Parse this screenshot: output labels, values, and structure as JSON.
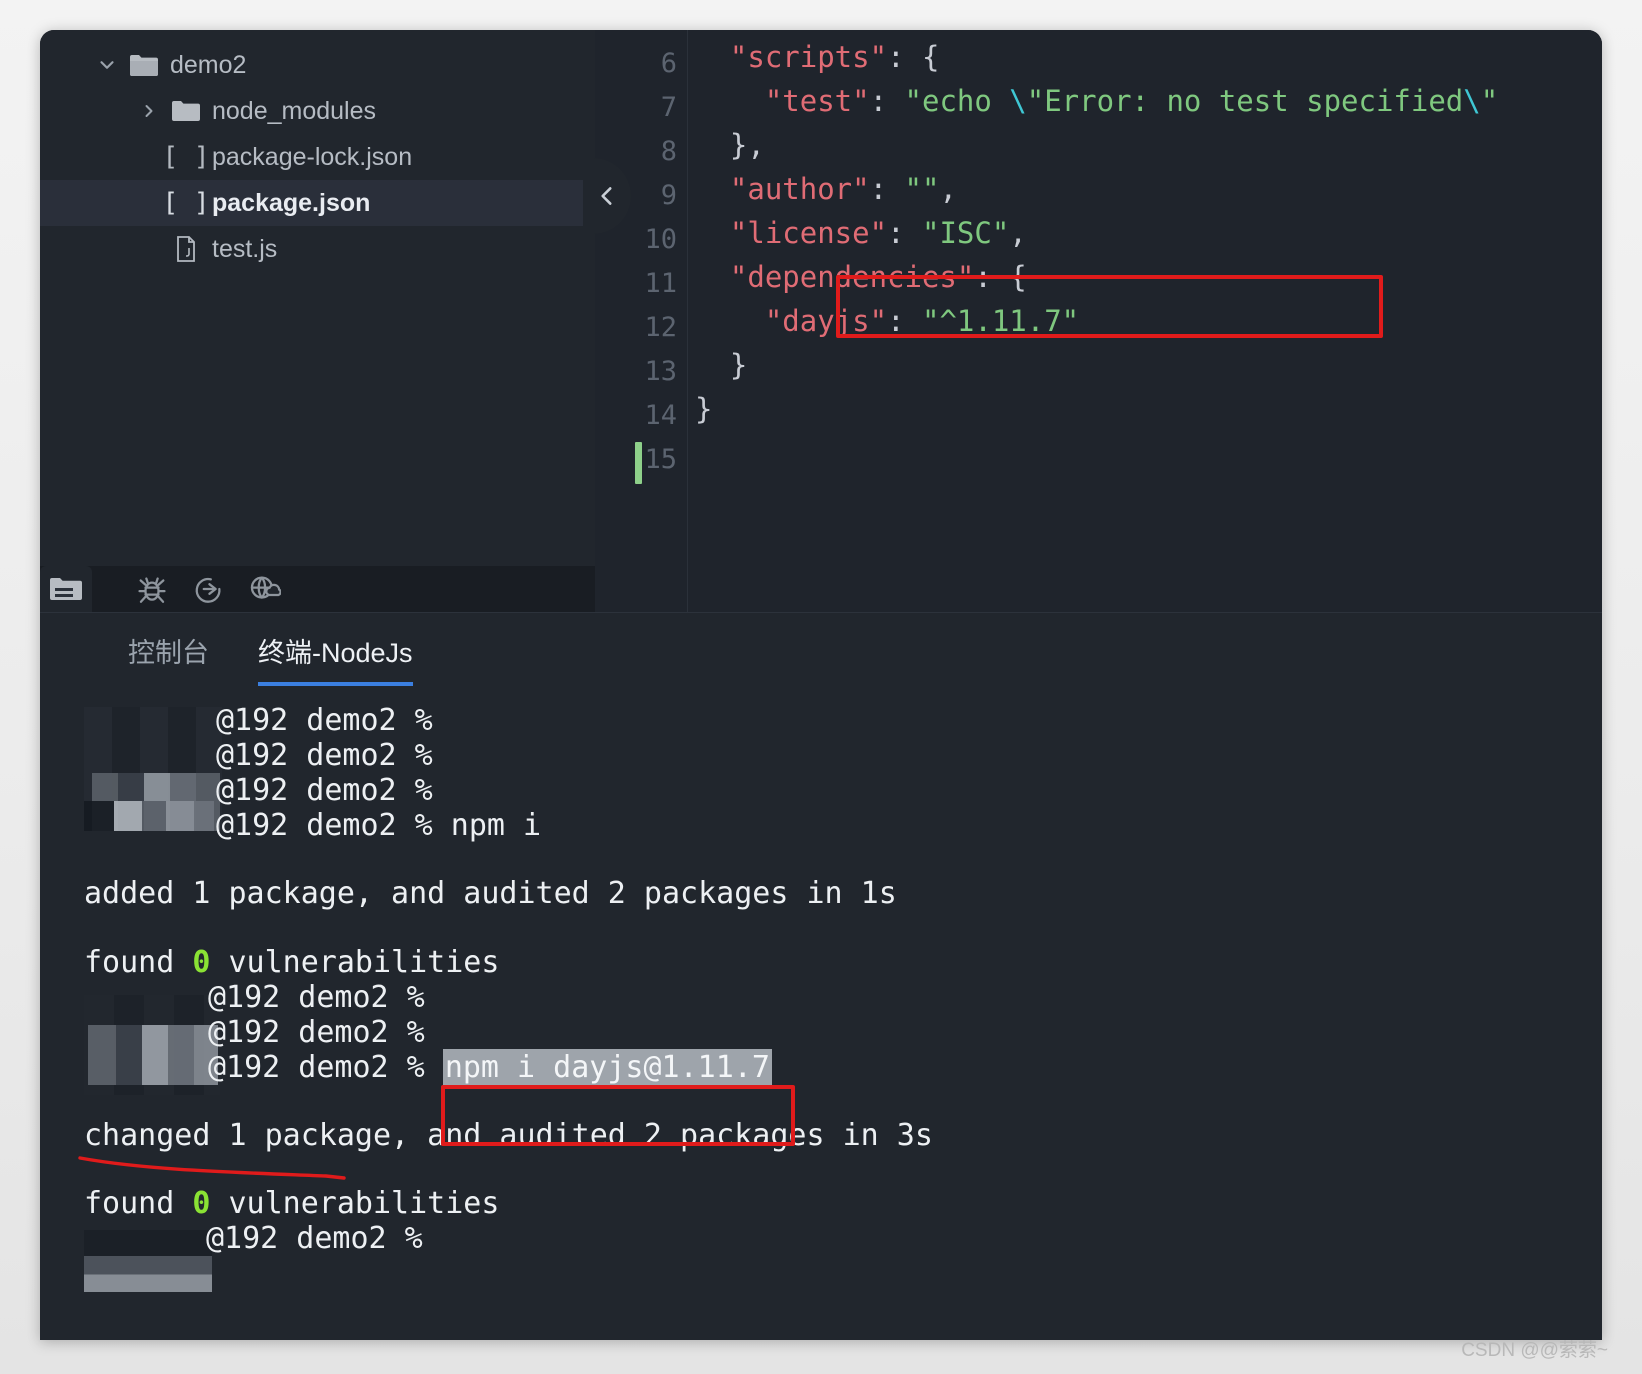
{
  "file_tree": {
    "items": [
      {
        "label": "demo2",
        "icon": "folder-open-icon",
        "twisty": "chevron-down-icon",
        "depth": 0,
        "selected": false
      },
      {
        "label": "node_modules",
        "icon": "folder-icon",
        "twisty": "chevron-right-icon",
        "depth": 1,
        "selected": false
      },
      {
        "label": "package-lock.json",
        "icon": "json-file-icon",
        "twisty": "",
        "depth": 2,
        "selected": false
      },
      {
        "label": "package.json",
        "icon": "json-file-icon",
        "twisty": "",
        "depth": 2,
        "selected": true
      },
      {
        "label": "test.js",
        "icon": "js-file-icon",
        "twisty": "",
        "depth": 2,
        "selected": false
      }
    ]
  },
  "toolbar": {
    "icons": [
      {
        "name": "project-files-icon",
        "active": true
      },
      {
        "name": "debug-bug-icon",
        "active": false
      },
      {
        "name": "run-arrow-icon",
        "active": false
      },
      {
        "name": "globe-cloud-icon",
        "active": false
      }
    ],
    "collapse_icon": "chevron-left-icon"
  },
  "editor": {
    "filename": "package.json",
    "line_numbers": [
      "6",
      "7",
      "8",
      "9",
      "10",
      "11",
      "12",
      "13",
      "14",
      "15"
    ],
    "lines": [
      {
        "num": "6",
        "text": "  \"scripts\": {"
      },
      {
        "num": "7",
        "text": "    \"test\": \"echo \\\"Error: no test specified\\\""
      },
      {
        "num": "8",
        "text": "  },"
      },
      {
        "num": "9",
        "text": "  \"author\": \"\","
      },
      {
        "num": "10",
        "text": "  \"license\": \"ISC\","
      },
      {
        "num": "11",
        "text": "  \"dependencies\": {"
      },
      {
        "num": "12",
        "text": "    \"dayjs\": \"^1.11.7\""
      },
      {
        "num": "13",
        "text": "  }"
      },
      {
        "num": "14",
        "text": "}"
      },
      {
        "num": "15",
        "text": ""
      }
    ],
    "highlight_note": "red box around line 12 dependency dayjs ^1.11.7"
  },
  "panel": {
    "tabs": [
      {
        "label": "控制台",
        "active": false
      },
      {
        "label": "终端-NodeJs",
        "active": true
      }
    ]
  },
  "terminal": {
    "lines": [
      {
        "prompt": "@192 demo2 %",
        "command": "",
        "blurred_user": true
      },
      {
        "prompt": "@192 demo2 %",
        "command": "",
        "blurred_user": true
      },
      {
        "prompt": "@192 demo2 %",
        "command": "",
        "blurred_user": true
      },
      {
        "prompt": "@192 demo2 %",
        "command": " npm i",
        "blurred_user": true
      },
      {
        "output": "added 1 package, and audited 2 packages in 1s"
      },
      {
        "output_prefix": "found ",
        "output_count": "0",
        "output_suffix": " vulnerabilities"
      },
      {
        "prompt": "@192 demo2 %",
        "command": "",
        "blurred_user": true
      },
      {
        "prompt": "@192 demo2 %",
        "command": "",
        "blurred_user": true
      },
      {
        "prompt": "@192 demo2 %",
        "command": " npm i dayjs@1.11.7",
        "selected": true,
        "blurred_user": true
      },
      {
        "output": "changed 1 package, and audited 2 packages in 3s",
        "underlined": true
      },
      {
        "output_prefix": "found ",
        "output_count": "0",
        "output_suffix": " vulnerabilities"
      },
      {
        "prompt": "@192 demo2 %",
        "command": "",
        "blurred_user": true
      }
    ],
    "text": {
      "added_line": "added 1 package, and audited 2 packages in 1s",
      "changed_line": "changed 1 package, and audited 2 packages in 3s",
      "found_prefix": "found ",
      "found_count": "0",
      "found_suffix": " vulnerabilities",
      "prompt": "@192 demo2 %",
      "cmd_npm_i": " npm i",
      "cmd_npm_dayjs": "npm i dayjs@1.11.7"
    }
  },
  "watermark": "CSDN @@萦萦~",
  "colors": {
    "accent": "#3b7fe0",
    "annotation_red": "#e01b1b",
    "string_green": "#7fc87f",
    "key_red": "#e06c75",
    "success_green": "#8ae234",
    "change_marker": "#8ed08a"
  }
}
